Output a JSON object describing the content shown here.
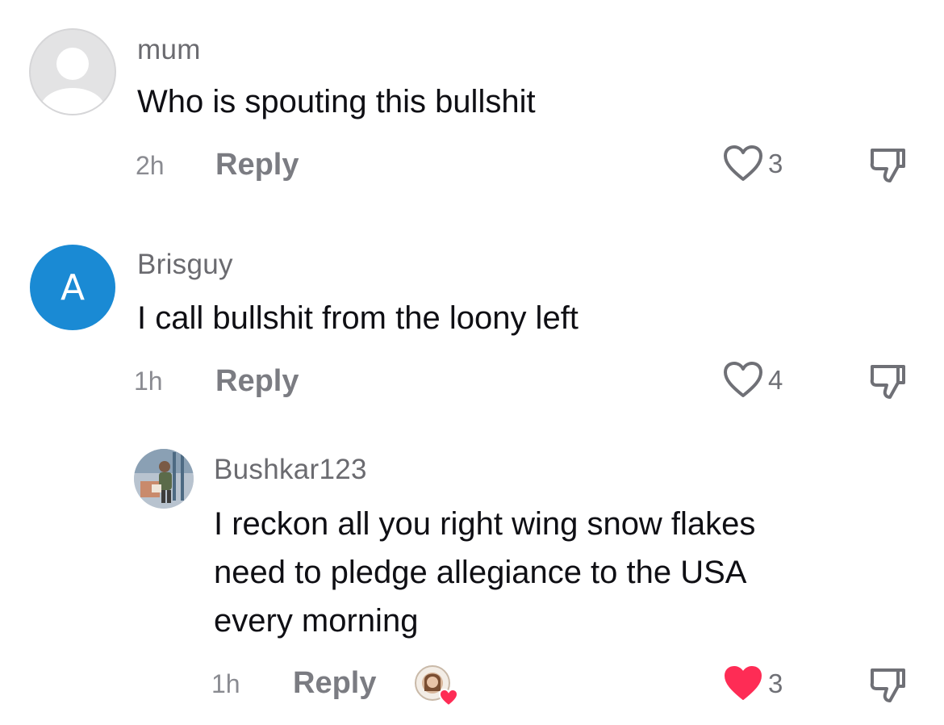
{
  "colors": {
    "liked": "#fe2c55",
    "avatar_blue": "#1a8ad4",
    "muted_text": "#7b7c82"
  },
  "comments": [
    {
      "username": "mum",
      "avatar": "default-user-icon",
      "text": "Who is spouting this bullshit",
      "time": "2h",
      "reply_label": "Reply",
      "likes": "3",
      "liked": false
    },
    {
      "username": "Brisguy",
      "avatar_letter": "A",
      "text": "I call bullshit from the loony left",
      "time": "1h",
      "reply_label": "Reply",
      "likes": "4",
      "liked": false
    },
    {
      "username": "Bushkar123",
      "avatar": "photo-avatar",
      "text_lines": [
        "I reckon all you right wing snow flakes",
        "need to pledge allegiance to the USA",
        "every morning"
      ],
      "time": "1h",
      "reply_label": "Reply",
      "creator_badge": "liked-by-creator-badge",
      "likes": "3",
      "liked": true
    }
  ]
}
